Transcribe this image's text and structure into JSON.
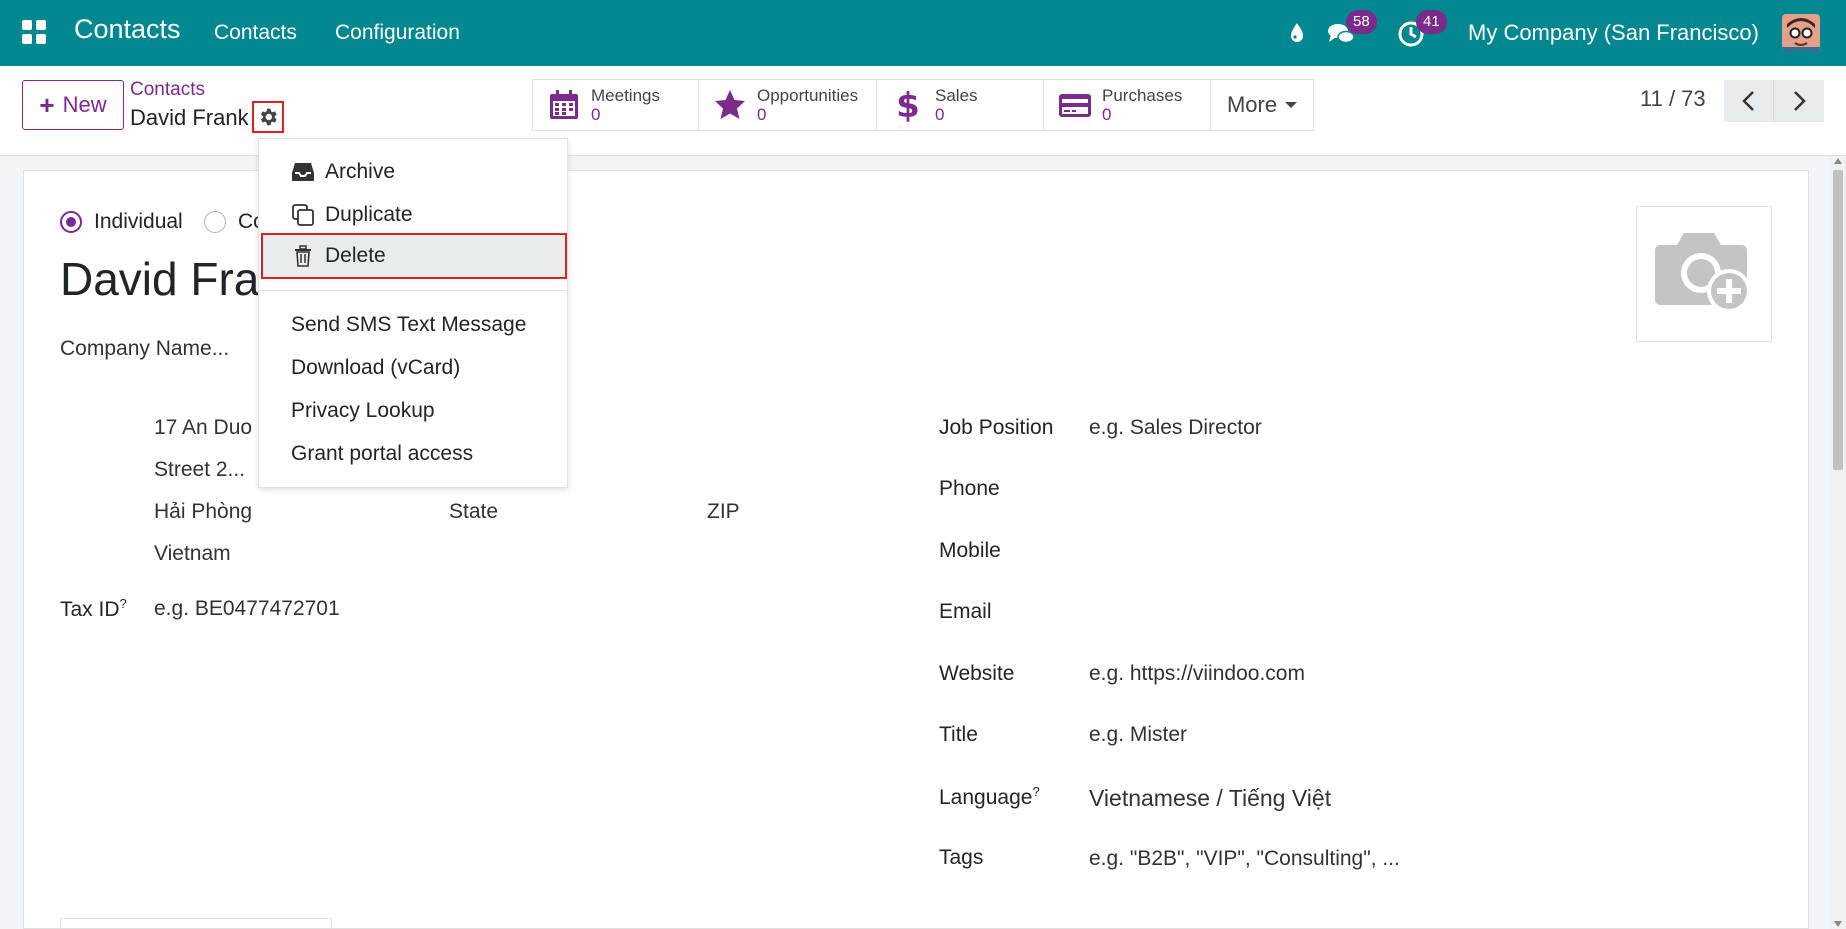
{
  "navbar": {
    "brand": "Contacts",
    "menu": [
      "Contacts",
      "Configuration"
    ],
    "messages_badge": "58",
    "activities_badge": "41",
    "company": "My Company (San Francisco)"
  },
  "control_panel": {
    "new_label": "New",
    "breadcrumb": "Contacts",
    "record_name": "David Frank",
    "smart_buttons": [
      {
        "label": "Meetings",
        "value": "0",
        "icon": "calendar-icon"
      },
      {
        "label": "Opportunities",
        "value": "0",
        "icon": "star-icon"
      },
      {
        "label": "Sales",
        "value": "0",
        "icon": "dollar-icon"
      },
      {
        "label": "Purchases",
        "value": "0",
        "icon": "credit-card-icon"
      }
    ],
    "more_label": "More",
    "pager": "11 / 73"
  },
  "dropdown": {
    "items": [
      "Archive",
      "Duplicate",
      "Delete",
      "Send SMS Text Message",
      "Download (vCard)",
      "Privacy Lookup",
      "Grant portal access"
    ]
  },
  "form": {
    "type_individual": "Individual",
    "type_company": "Co",
    "name": "David Fra",
    "company_placeholder": "Company Name...",
    "street": "17 An Duo",
    "street2_placeholder": "Street 2...",
    "city": "Hải Phòng",
    "state_placeholder": "State",
    "zip_placeholder": "ZIP",
    "country": "Vietnam",
    "tax_id_label": "Tax ID",
    "tax_id_help": "?",
    "tax_id_placeholder": "e.g. BE0477472701",
    "job_position_label": "Job Position",
    "job_position_placeholder": "e.g. Sales Director",
    "phone_label": "Phone",
    "mobile_label": "Mobile",
    "email_label": "Email",
    "website_label": "Website",
    "website_placeholder": "e.g. https://viindoo.com",
    "title_label": "Title",
    "title_placeholder": "e.g. Mister",
    "language_label": "Language",
    "language_help": "?",
    "language_value": "Vietnamese / Tiếng Việt",
    "tags_label": "Tags",
    "tags_placeholder": "e.g. \"B2B\", \"VIP\", \"Consulting\", ..."
  },
  "colors": {
    "navbar": "#00878f",
    "accent": "#7c2a8c",
    "highlight_border": "#e02020"
  }
}
